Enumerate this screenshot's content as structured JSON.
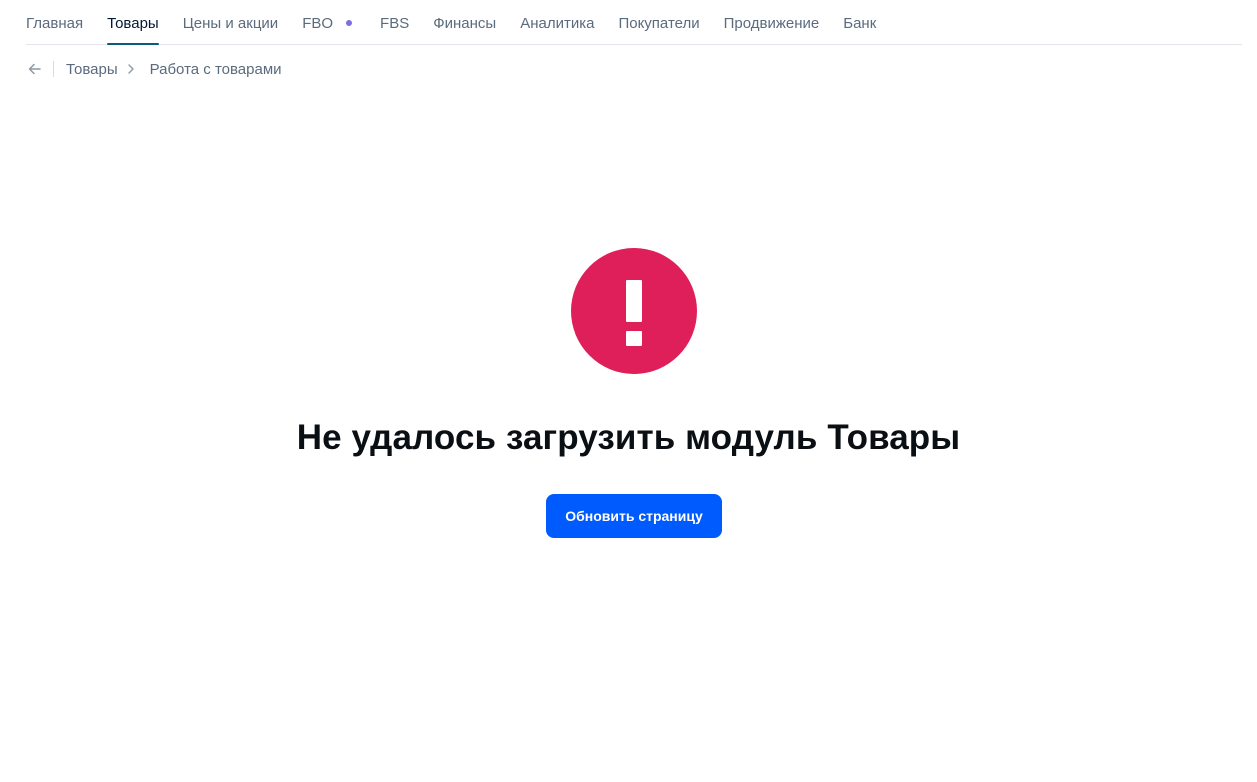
{
  "nav": {
    "tabs": [
      {
        "label": "Главная"
      },
      {
        "label": "Товары"
      },
      {
        "label": "Цены и акции"
      },
      {
        "label": "FBO"
      },
      {
        "label": "FBS"
      },
      {
        "label": "Финансы"
      },
      {
        "label": "Аналитика"
      },
      {
        "label": "Покупатели"
      },
      {
        "label": "Продвижение"
      },
      {
        "label": "Банк"
      }
    ],
    "active_tab": "Товары",
    "fbo_dot_color": "#7b6fe0"
  },
  "breadcrumbs": {
    "back_icon": "arrow-left-icon",
    "items": [
      "Товары",
      "Работа с товарами"
    ]
  },
  "error": {
    "icon": "exclamation-icon",
    "icon_color": "#df1f5a",
    "title": "Не удалось загрузить модуль Товары",
    "button_label": "Обновить страницу",
    "button_color": "#005bff"
  }
}
